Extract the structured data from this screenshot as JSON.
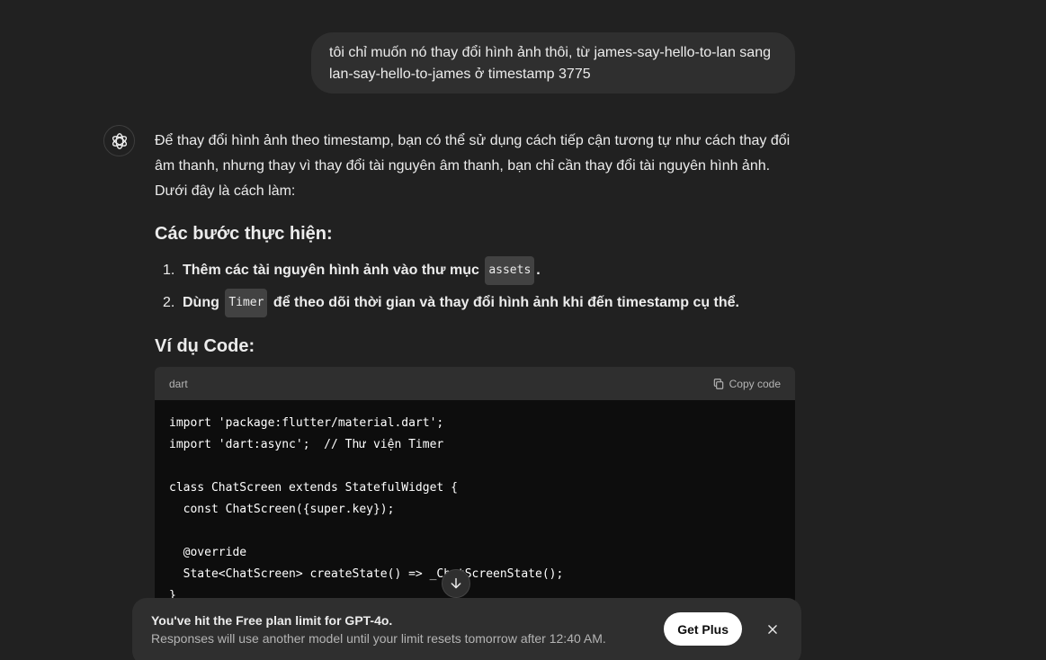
{
  "user_message": {
    "text": "tôi chỉ muốn nó thay đổi hình ảnh thôi, từ james-say-hello-to-lan sang lan-say-hello-to-james ở timestamp 3775"
  },
  "assistant": {
    "avatar_icon": "openai-logo-icon",
    "intro": "Để thay đổi hình ảnh theo timestamp, bạn có thể sử dụng cách tiếp cận tương tự như cách thay đổi âm thanh, nhưng thay vì thay đổi tài nguyên âm thanh, bạn chỉ cần thay đổi tài nguyên hình ảnh. Dưới đây là cách làm:",
    "steps_heading": "Các bước thực hiện:",
    "steps": [
      {
        "num": "1.",
        "before": "Thêm các tài nguyên hình ảnh vào thư mục ",
        "code": "assets",
        "after": "."
      },
      {
        "num": "2.",
        "before": "Dùng ",
        "code": "Timer",
        "after": " để theo dõi thời gian và thay đổi hình ảnh khi đến timestamp cụ thể."
      }
    ],
    "example_heading": "Ví dụ Code:"
  },
  "code_block": {
    "language": "dart",
    "copy_label": "Copy code",
    "lines": [
      "import 'package:flutter/material.dart';",
      "import 'dart:async';  // Thư viện Timer",
      "",
      "class ChatScreen extends StatefulWidget {",
      "  const ChatScreen({super.key});",
      "",
      "  @override",
      "  State<ChatScreen> createState() => _ChatScreenState();",
      "}"
    ]
  },
  "limit_banner": {
    "title": "You've hit the Free plan limit for GPT-4o.",
    "subtitle": "Responses will use another model until your limit resets tomorrow after 12:40 AM.",
    "button_label": "Get Plus"
  },
  "icons": {
    "copy": "copy-icon",
    "close": "close-icon",
    "scroll_down": "arrow-down-icon"
  },
  "colors": {
    "background": "#212121",
    "bubble": "#2f2f2f",
    "code_bg": "#0d0d0d",
    "text": "#ececec",
    "muted": "#b4b4b4",
    "button_bg": "#ffffff"
  }
}
